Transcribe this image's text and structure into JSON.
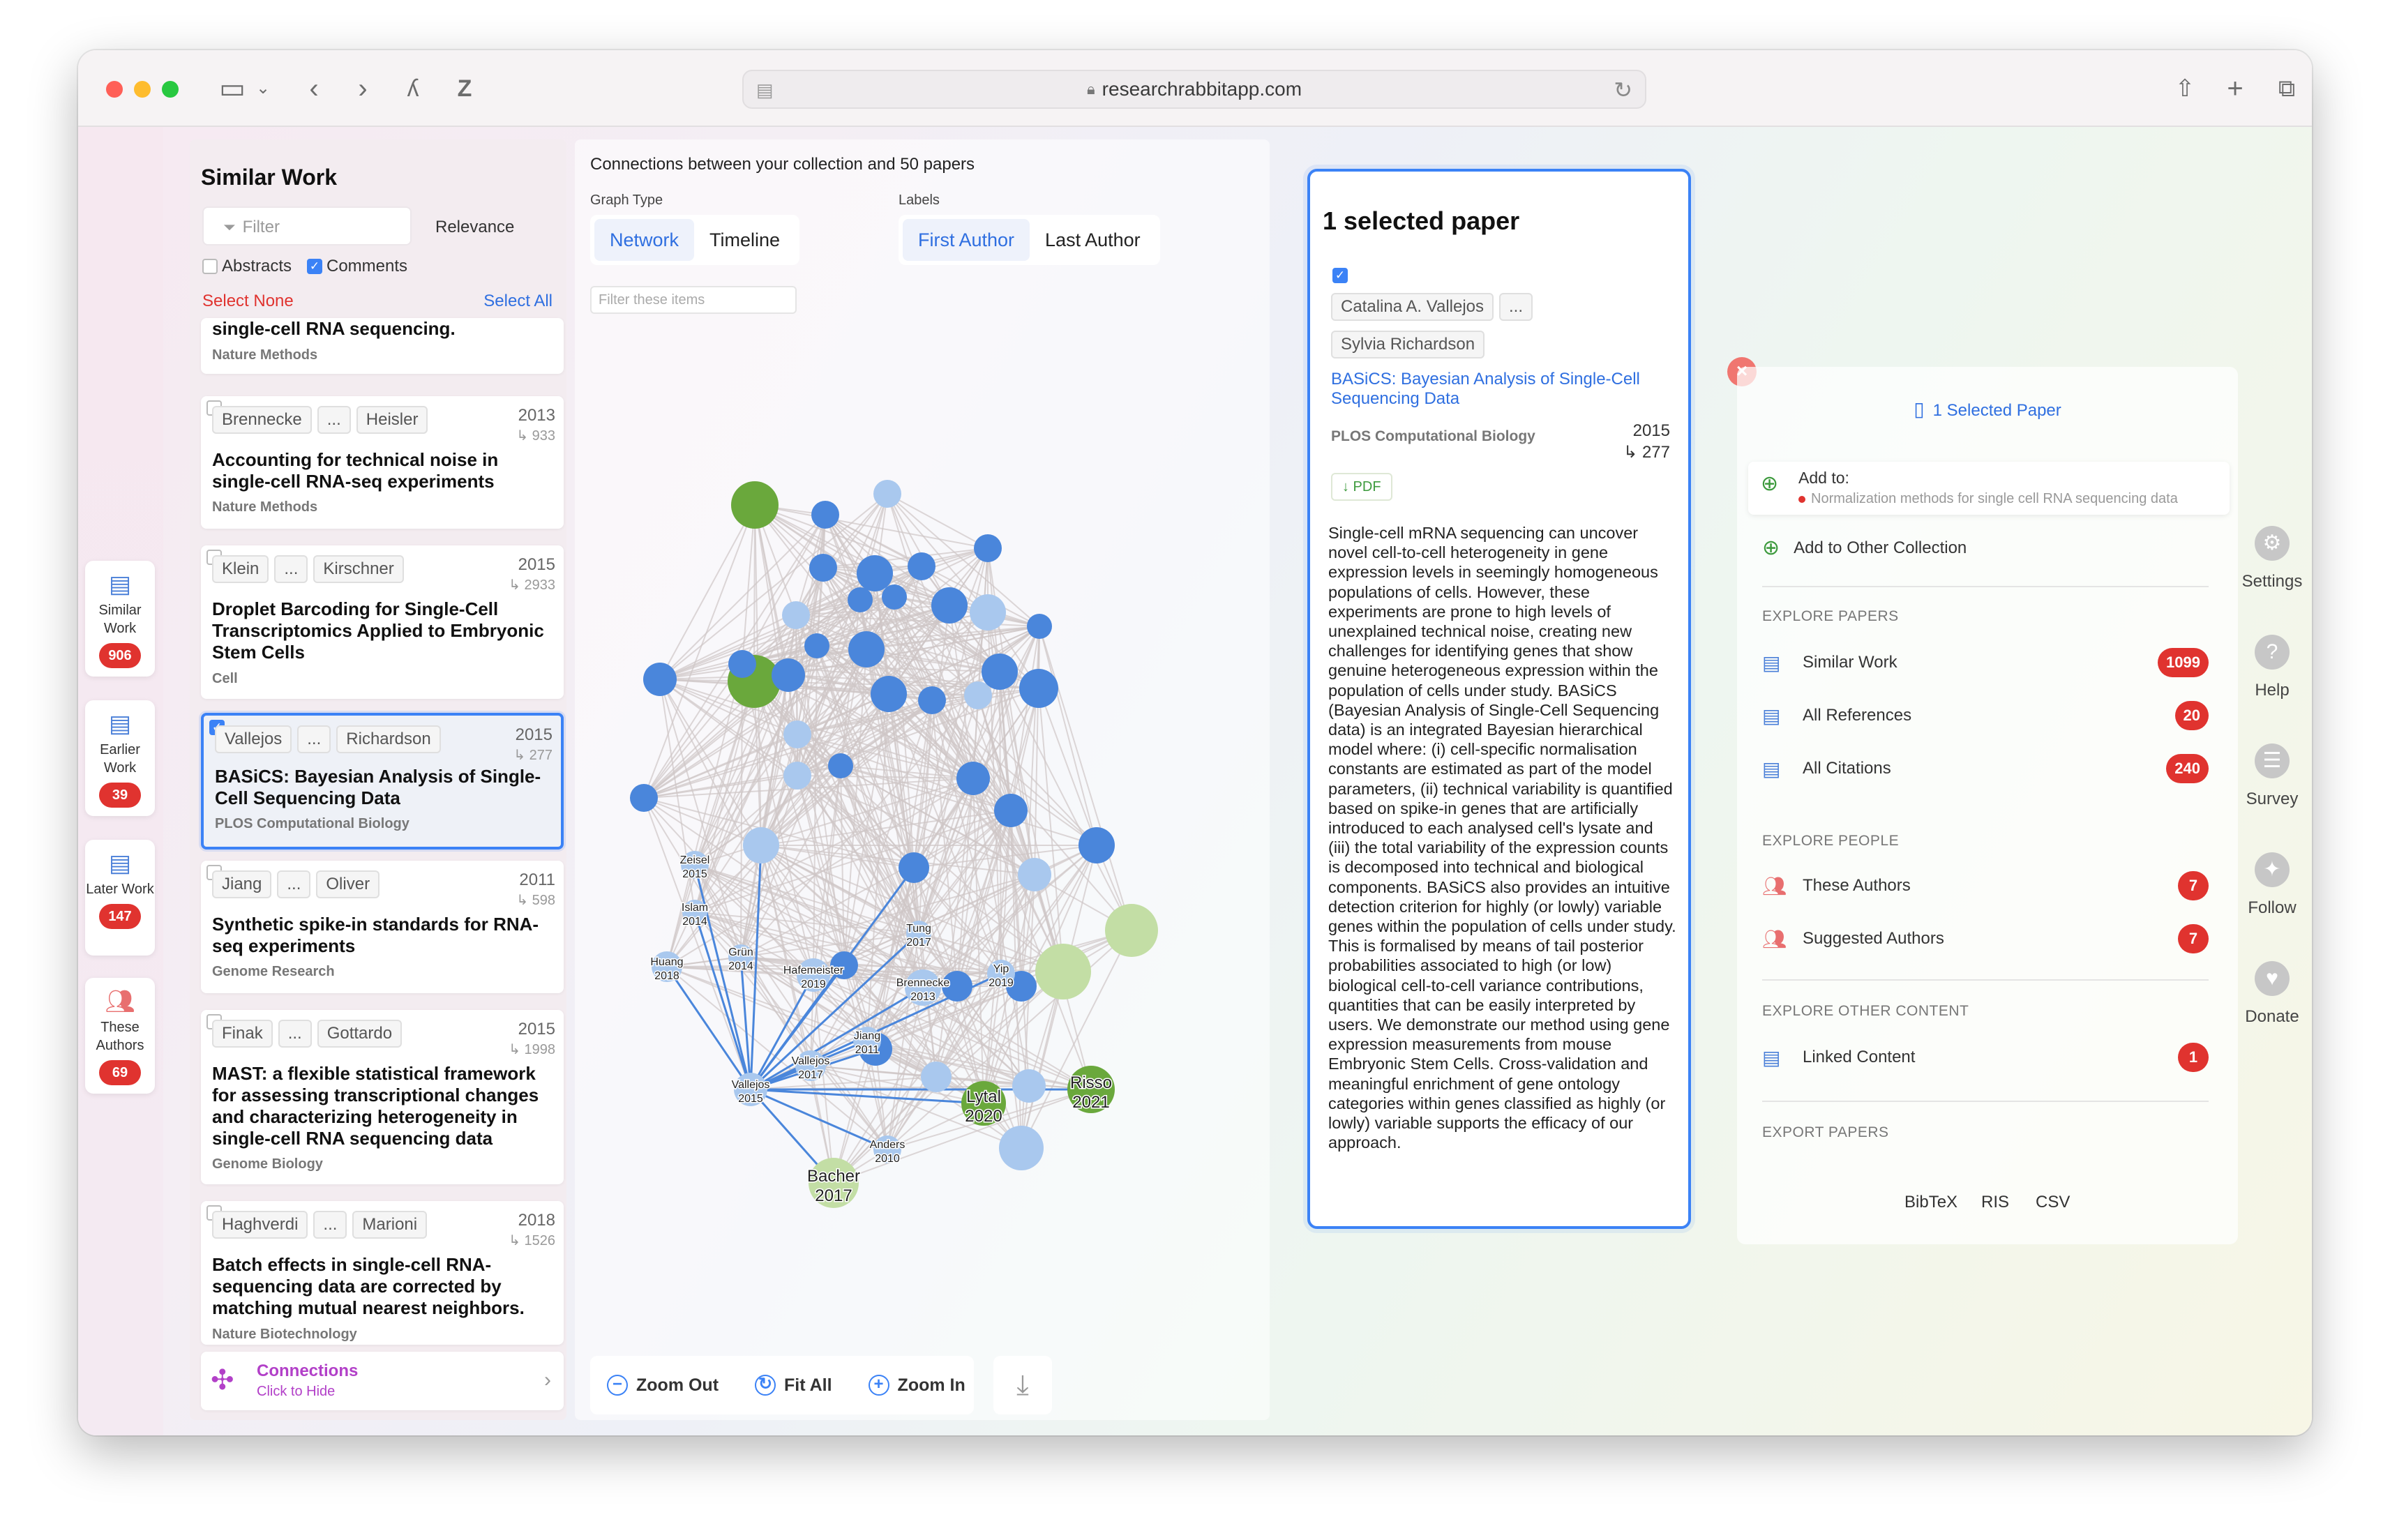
{
  "browser": {
    "url": "researchrabbitapp.com"
  },
  "rail": [
    {
      "label": "Similar Work",
      "count": "906"
    },
    {
      "label": "Earlier Work",
      "count": "39"
    },
    {
      "label": "Later Work",
      "count": "147"
    },
    {
      "label": "These Authors",
      "count": "69"
    }
  ],
  "similar": {
    "title": "Similar Work",
    "filter_placeholder": "Filter",
    "sort": "Relevance",
    "abstracts_label": "Abstracts",
    "comments_label": "Comments",
    "select_none": "Select None",
    "select_all": "Select All",
    "partial_title": "single-cell RNA sequencing.",
    "partial_journal": "Nature Methods",
    "papers": [
      {
        "a1": "Brennecke",
        "a2": "Heisler",
        "year": "2013",
        "cites": "↳ 933",
        "title": "Accounting for technical noise in single-cell RNA-seq experiments",
        "journal": "Nature Methods"
      },
      {
        "a1": "Klein",
        "a2": "Kirschner",
        "year": "2015",
        "cites": "↳ 2933",
        "title": "Droplet Barcoding for Single-Cell Transcriptomics Applied to Embryonic Stem Cells",
        "journal": "Cell"
      },
      {
        "a1": "Vallejos",
        "a2": "Richardson",
        "year": "2015",
        "cites": "↳ 277",
        "title": "BASiCS: Bayesian Analysis of Single-Cell Sequencing Data",
        "journal": "PLOS Computational Biology"
      },
      {
        "a1": "Jiang",
        "a2": "Oliver",
        "year": "2011",
        "cites": "↳ 598",
        "title": "Synthetic spike-in standards for RNA-seq experiments",
        "journal": "Genome Research"
      },
      {
        "a1": "Finak",
        "a2": "Gottardo",
        "year": "2015",
        "cites": "↳ 1998",
        "title": "MAST: a flexible statistical framework for assessing transcriptional changes and characterizing heterogeneity in single-cell RNA sequencing data",
        "journal": "Genome Biology"
      },
      {
        "a1": "Haghverdi",
        "a2": "Marioni",
        "year": "2018",
        "cites": "↳ 1526",
        "title": "Batch effects in single-cell RNA-sequencing data are corrected by matching mutual nearest neighbors.",
        "journal": "Nature Biotechnology"
      }
    ],
    "ellipsis": "...",
    "connections_title": "Connections",
    "connections_sub": "Click to Hide"
  },
  "graph": {
    "heading": "Connections between your collection and 50 papers",
    "graph_type_label": "Graph Type",
    "labels_label": "Labels",
    "type_network": "Network",
    "type_timeline": "Timeline",
    "label_first": "First Author",
    "label_last": "Last Author",
    "filter_placeholder": "Filter these items",
    "zoom_out": "Zoom Out",
    "fit_all": "Fit All",
    "zoom_in": "Zoom In",
    "node_labels": [
      {
        "name": "Zeisel",
        "year": "2015"
      },
      {
        "name": "Islam",
        "year": "2014"
      },
      {
        "name": "Huang",
        "year": "2018"
      },
      {
        "name": "Grün",
        "year": "2014"
      },
      {
        "name": "Hafemeister",
        "year": "2019"
      },
      {
        "name": "Brennecke",
        "year": "2013"
      },
      {
        "name": "Tung",
        "year": "2017"
      },
      {
        "name": "Yip",
        "year": "2019"
      },
      {
        "name": "Jiang",
        "year": "2011"
      },
      {
        "name": "Vallejos",
        "year": "2017"
      },
      {
        "name": "Vallejos",
        "year": "2015"
      },
      {
        "name": "Lytal",
        "year": "2020"
      },
      {
        "name": "Risso",
        "year": "2021"
      },
      {
        "name": "Anders",
        "year": "2010"
      },
      {
        "name": "Bacher",
        "year": "2017"
      }
    ]
  },
  "selected": {
    "title": "1 selected paper",
    "author1": "Catalina A. Vallejos",
    "author_more": "...",
    "author2": "Sylvia Richardson",
    "paper_title": "BASiCS: Bayesian Analysis of Single-Cell Sequencing Data",
    "journal": "PLOS Computational Biology",
    "year": "2015",
    "cites": "↳ 277",
    "pdf": "↓ PDF",
    "abstract": "Single-cell mRNA sequencing can uncover novel cell-to-cell heterogeneity in gene expression levels in seemingly homogeneous populations of cells. However, these experiments are prone to high levels of unexplained technical noise, creating new challenges for identifying genes that show genuine heterogeneous expression within the population of cells under study. BASiCS (Bayesian Analysis of Single-Cell Sequencing data) is an integrated Bayesian hierarchical model where: (i) cell-specific normalisation constants are estimated as part of the model parameters, (ii) technical variability is quantified based on spike-in genes that are artificially introduced to each analysed cell's lysate and (iii) the total variability of the expression counts is decomposed into technical and biological components. BASiCS also provides an intuitive detection criterion for highly (or lowly) variable genes within the population of cells under study. This is formalised by means of tail posterior probabilities associated to high (or low) biological cell-to-cell variance contributions, quantities that can be easily interpreted by users. We demonstrate our method using gene expression measurements from mouse Embryonic Stem Cells. Cross-validation and meaningful enrichment of gene ontology categories within genes classified as highly (or lowly) variable supports the efficacy of our approach."
  },
  "panel": {
    "header": "1 Selected Paper",
    "add_to": "Add to:",
    "add_to_collection": "Normalization methods for single cell RNA sequencing data",
    "add_other": "Add to Other Collection",
    "explore_papers": "EXPLORE PAPERS",
    "similar_work": "Similar Work",
    "similar_work_count": "1099",
    "all_references": "All References",
    "all_references_count": "20",
    "all_citations": "All Citations",
    "all_citations_count": "240",
    "explore_people": "EXPLORE PEOPLE",
    "these_authors": "These Authors",
    "these_authors_count": "7",
    "suggested_authors": "Suggested Authors",
    "suggested_authors_count": "7",
    "explore_other": "EXPLORE OTHER CONTENT",
    "linked_content": "Linked Content",
    "linked_content_count": "1",
    "export_papers": "EXPORT PAPERS",
    "bibtex": "BibTeX",
    "ris": "RIS",
    "csv": "CSV"
  },
  "right_rail": [
    "Settings",
    "Help",
    "Survey",
    "Follow",
    "Donate"
  ],
  "colors": {
    "accent_blue": "#3b82f6",
    "badge_red": "#e0332f",
    "node_blue": "#4a86db",
    "node_light_blue": "#a9c8ee",
    "node_green": "#6aa83c",
    "node_light_green": "#c3dea5"
  }
}
